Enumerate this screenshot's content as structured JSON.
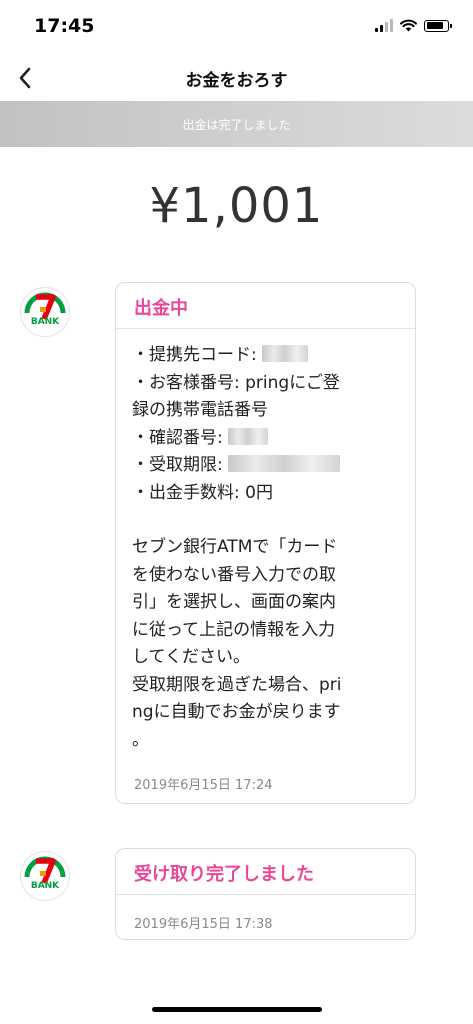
{
  "status_bar": {
    "time": "17:45",
    "battery_level": 0.85
  },
  "nav": {
    "title": "お金をおろす"
  },
  "banner": {
    "text": "出金は完了しました"
  },
  "amount": "¥1,001",
  "bank_logo": {
    "icon": "seven-bank-logo",
    "text": "BANK",
    "colors": {
      "red": "#e60012",
      "green": "#00a040",
      "orange": "#f39800"
    }
  },
  "messages": [
    {
      "title": "出金中",
      "details": [
        "・提携先コード: ",
        "・お客様番号: pringにご登",
        "録の携帯電話番号",
        "・確認番号: ",
        "・受取期限: ",
        "・出金手数料: 0円"
      ],
      "instructions": [
        "セブン銀行ATMで「カード",
        "を使わない番号入力での取",
        "引」を選択し、画面の案内",
        "に従って上記の情報を入力",
        "してください。",
        "受取期限を過ぎた場合、pri",
        "ngに自動でお金が戻ります",
        "。"
      ],
      "date": "2019年6月15日 17:24"
    },
    {
      "title": "受け取り完了しました",
      "date": "2019年6月15日 17:38"
    }
  ],
  "colors": {
    "accent": "#e8479a",
    "banner": "#cfcfcf"
  }
}
